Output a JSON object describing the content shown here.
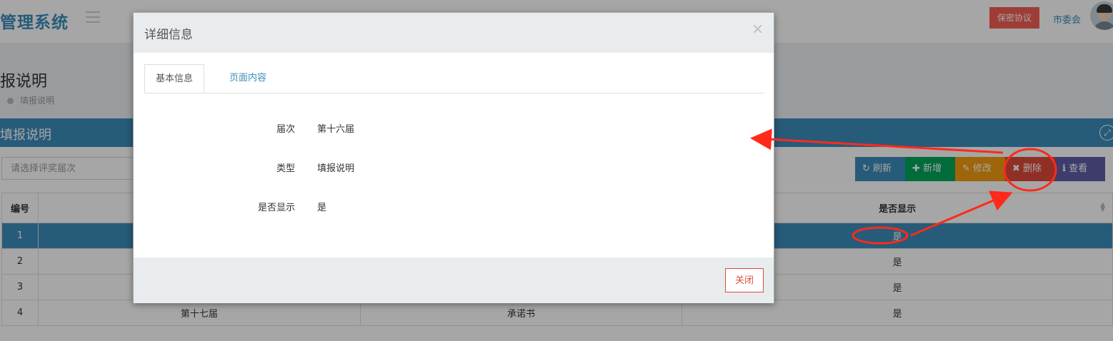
{
  "header": {
    "brand": "管理系统",
    "secret_button": "保密协议",
    "user_name": "市委会"
  },
  "page": {
    "title": "报说明",
    "breadcrumb": "填报说明",
    "box_title": "填报说明",
    "filter_placeholder": "请选择评奖届次",
    "footer_hint": ""
  },
  "toolbar": {
    "refresh": "刷新",
    "add": "新增",
    "edit": "修改",
    "delete": "删除",
    "view": "查看"
  },
  "table": {
    "columns": [
      "编号",
      "",
      "",
      "是否显示"
    ],
    "rows": [
      {
        "no": "1",
        "session": "",
        "type": "",
        "show": "是"
      },
      {
        "no": "2",
        "session": "",
        "type": "",
        "show": "是"
      },
      {
        "no": "3",
        "session": "",
        "type": "",
        "show": "是"
      },
      {
        "no": "4",
        "session": "第十七届",
        "type": "承诺书",
        "show": "是"
      }
    ]
  },
  "modal": {
    "title": "详细信息",
    "close_symbol": "×",
    "tabs": [
      "基本信息",
      "页面内容"
    ],
    "fields": [
      {
        "label": "届次",
        "value": "第十六届"
      },
      {
        "label": "类型",
        "value": "填报说明"
      },
      {
        "label": "是否显示",
        "value": "是"
      }
    ],
    "close_button": "关闭"
  },
  "colors": {
    "primary": "#3c8dbc",
    "danger": "#dd4b39",
    "annotation": "#ff2a1a"
  }
}
